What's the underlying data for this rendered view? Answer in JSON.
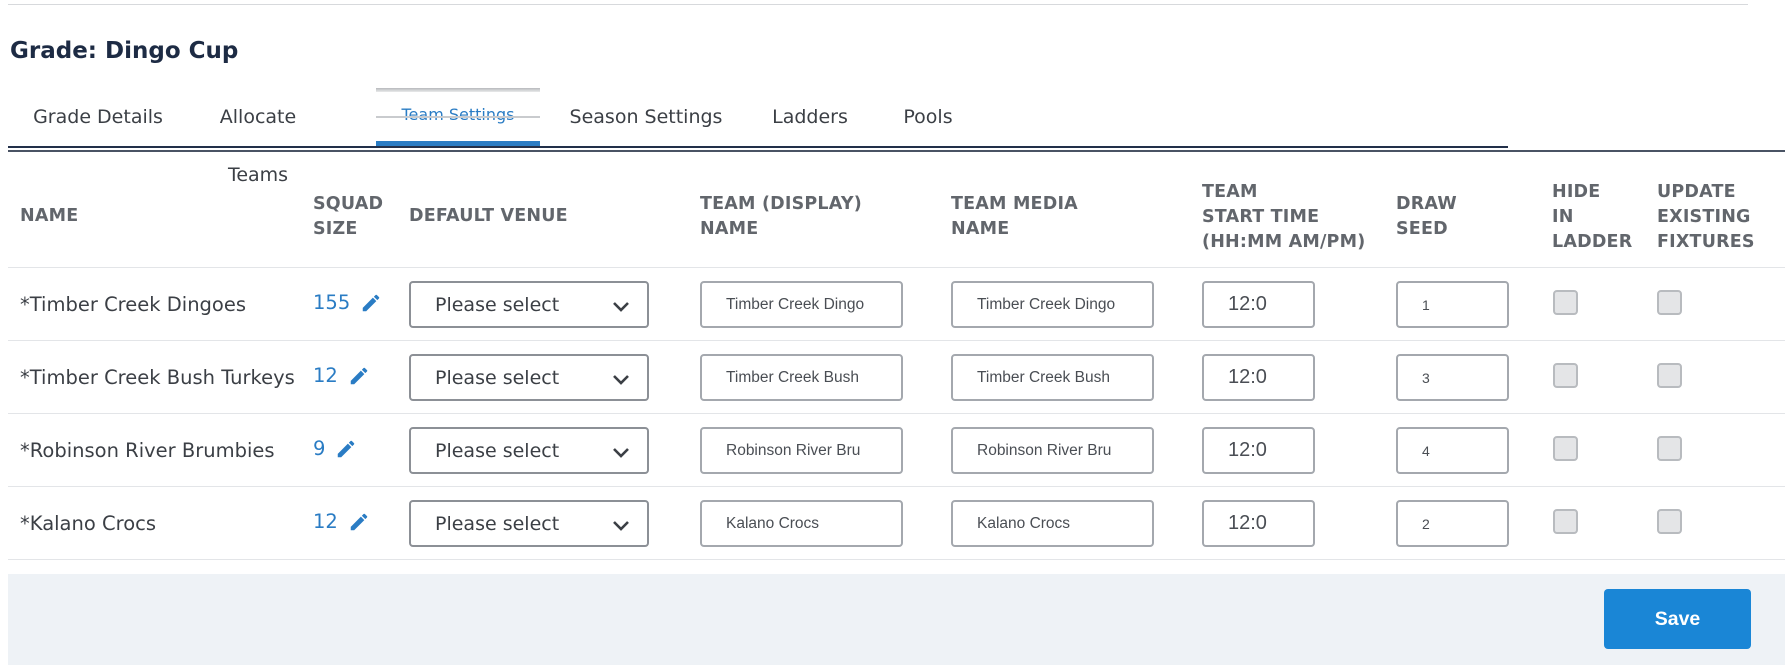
{
  "grade": {
    "title": "Grade: Dingo Cup"
  },
  "tabs": [
    {
      "label": "Grade Details"
    },
    {
      "label": "Allocate Teams"
    },
    {
      "label": "Team Settings"
    },
    {
      "label": "Season Settings"
    },
    {
      "label": "Ladders"
    },
    {
      "label": "Pools"
    }
  ],
  "active_tab": "Team Settings",
  "columns": {
    "name": "NAME",
    "squad_l1": "SQUAD",
    "squad_l2": "SIZE",
    "venue": "DEFAULT VENUE",
    "display_l1": "TEAM (DISPLAY)",
    "display_l2": "NAME",
    "media_l1": "TEAM MEDIA",
    "media_l2": "NAME",
    "start_l1": "TEAM",
    "start_l2": "START TIME",
    "start_l3": "(HH:MM AM/PM)",
    "seed_l1": "DRAW",
    "seed_l2": "SEED",
    "hide_l1": "HIDE",
    "hide_l2": "IN",
    "hide_l3": "LADDER",
    "update_l1": "UPDATE",
    "update_l2": "EXISTING",
    "update_l3": "FIXTURES"
  },
  "rows": [
    {
      "name": "*Timber Creek Dingoes",
      "squad_size": "155",
      "venue": "Please select",
      "display_name": "Timber Creek Dingo",
      "media_name": "Timber Creek Dingo",
      "start_time": "12:0",
      "draw_seed": "1"
    },
    {
      "name": "*Timber Creek Bush Turkeys",
      "squad_size": "12",
      "venue": "Please select",
      "display_name": "Timber Creek Bush",
      "media_name": "Timber Creek Bush",
      "start_time": "12:0",
      "draw_seed": "3"
    },
    {
      "name": "*Robinson River Brumbies",
      "squad_size": "9",
      "venue": "Please select",
      "display_name": "Robinson River Bru",
      "media_name": "Robinson River Bru",
      "start_time": "12:0",
      "draw_seed": "4"
    },
    {
      "name": "*Kalano Crocs",
      "squad_size": "12",
      "venue": "Please select",
      "display_name": "Kalano Crocs",
      "media_name": "Kalano Crocs",
      "start_time": "12:0",
      "draw_seed": "2"
    }
  ],
  "footer": {
    "save_label": "Save"
  },
  "colors": {
    "accent": "#2a7cc4",
    "save_button": "#1a86d6",
    "heading": "#1d2b44"
  },
  "icons": {
    "edit": "pencil-icon",
    "dropdown": "chevron-down-icon"
  }
}
